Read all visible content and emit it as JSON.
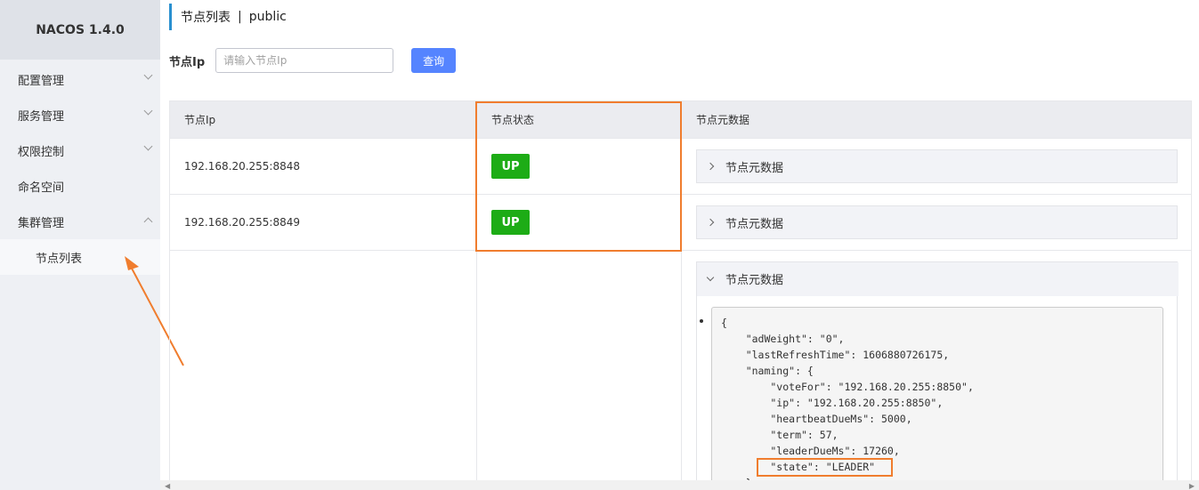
{
  "brand": "NACOS 1.4.0",
  "sidebar": {
    "items": [
      {
        "label": "配置管理"
      },
      {
        "label": "服务管理"
      },
      {
        "label": "权限控制"
      },
      {
        "label": "命名空间"
      },
      {
        "label": "集群管理"
      }
    ],
    "subitems": [
      {
        "label": "节点列表"
      }
    ]
  },
  "page": {
    "title": "节点列表",
    "separator": "|",
    "namespace": "public"
  },
  "search": {
    "label": "节点Ip",
    "placeholder": "请输入节点Ip",
    "button": "查询"
  },
  "table": {
    "headers": [
      "节点Ip",
      "节点状态",
      "节点元数据"
    ],
    "rows": [
      {
        "ip": "192.168.20.255:8848",
        "status": "UP",
        "meta_label": "节点元数据"
      },
      {
        "ip": "192.168.20.255:8849",
        "status": "UP",
        "meta_label": "节点元数据"
      },
      {
        "ip": "",
        "status": "",
        "meta_label": "节点元数据"
      }
    ]
  },
  "metadata_json": "{\n    \"adWeight\": \"0\",\n    \"lastRefreshTime\": 1606880726175,\n    \"naming\": {\n        \"voteFor\": \"192.168.20.255:8850\",\n        \"ip\": \"192.168.20.255:8850\",\n        \"heartbeatDueMs\": 5000,\n        \"term\": 57,\n        \"leaderDueMs\": 17260,\n        \"state\": \"LEADER\"\n    },",
  "colors": {
    "accent": "#2a90d0",
    "button": "#5584ff",
    "status_up": "#1dac16",
    "highlight": "#f07d2e"
  }
}
